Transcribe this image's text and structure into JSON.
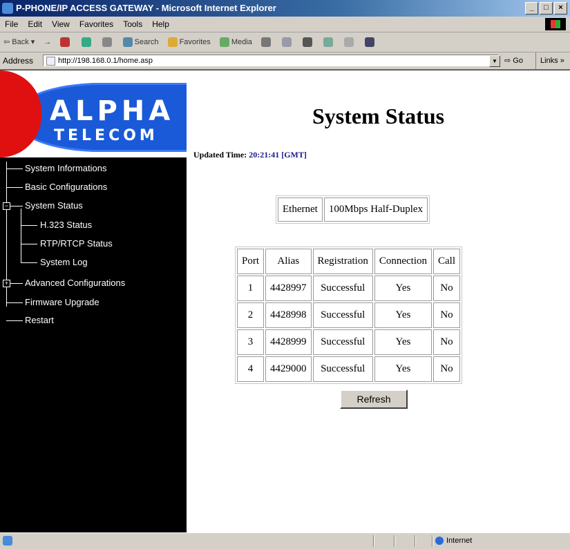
{
  "window": {
    "title": "P-PHONE/IP ACCESS GATEWAY - Microsoft Internet Explorer",
    "buttons": [
      "_",
      "□",
      "×"
    ]
  },
  "menu": [
    "File",
    "Edit",
    "View",
    "Favorites",
    "Tools",
    "Help"
  ],
  "toolbar": {
    "back": "Back",
    "forward": "→",
    "search": "Search",
    "favorites": "Favorites",
    "media": "Media"
  },
  "address": {
    "label": "Address",
    "url": "http://198.168.0.1/home.asp",
    "go": "Go",
    "links": "Links »"
  },
  "logo": {
    "line1": "ALPHA",
    "line2": "TELECOM"
  },
  "nav": {
    "system_informations": "System Informations",
    "basic_configurations": "Basic Configurations",
    "system_status": "System Status",
    "h323_status": "H.323 Status",
    "rtp_status": "RTP/RTCP Status",
    "system_log": "System Log",
    "advanced_configurations": "Advanced Configurations",
    "firmware_upgrade": "Firmware Upgrade",
    "restart": "Restart"
  },
  "page": {
    "title": "System Status",
    "updated_label": "Updated Time:",
    "updated_value": "20:21:41 [GMT]"
  },
  "ethernet": {
    "label": "Ethernet",
    "value": "100Mbps Half-Duplex"
  },
  "table": {
    "headers": [
      "Port",
      "Alias",
      "Registration",
      "Connection",
      "Call"
    ],
    "rows": [
      [
        "1",
        "4428997",
        "Successful",
        "Yes",
        "No"
      ],
      [
        "2",
        "4428998",
        "Successful",
        "Yes",
        "No"
      ],
      [
        "3",
        "4428999",
        "Successful",
        "Yes",
        "No"
      ],
      [
        "4",
        "4429000",
        "Successful",
        "Yes",
        "No"
      ]
    ]
  },
  "refresh_label": "Refresh",
  "status": {
    "zone": "Internet"
  }
}
